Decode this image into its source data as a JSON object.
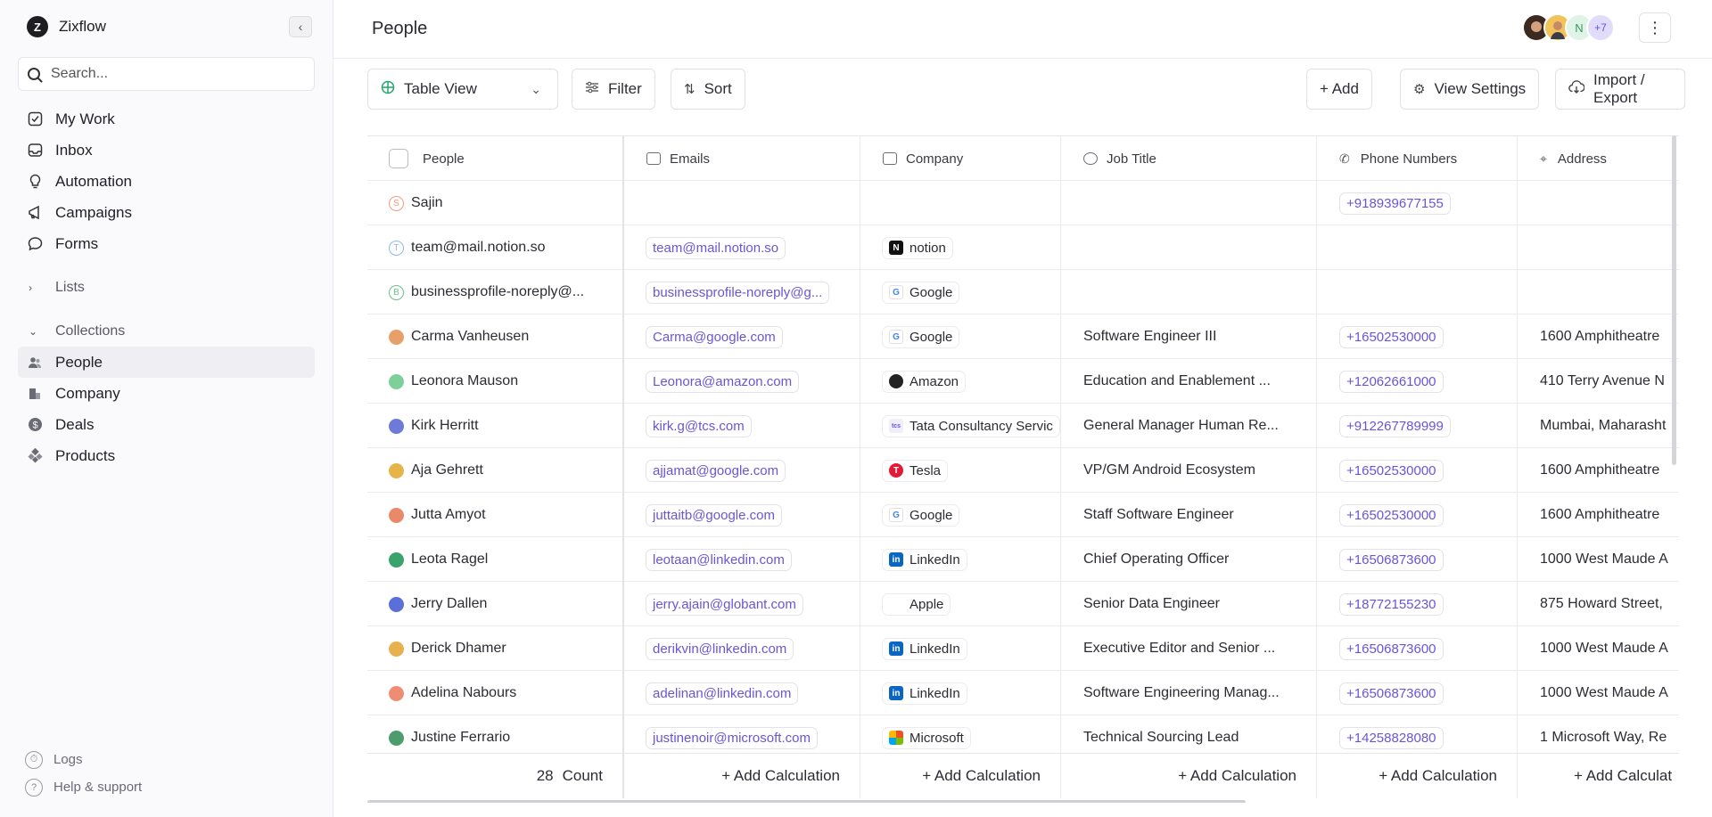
{
  "sidebar": {
    "brand": "Zixflow",
    "search_placeholder": "Search...",
    "nav": [
      {
        "label": "My Work",
        "icon": "check-square-icon"
      },
      {
        "label": "Inbox",
        "icon": "inbox-icon"
      },
      {
        "label": "Automation",
        "icon": "bulb-icon"
      },
      {
        "label": "Campaigns",
        "icon": "megaphone-icon"
      },
      {
        "label": "Forms",
        "icon": "chat-bubble-icon"
      }
    ],
    "lists_label": "Lists",
    "collections_label": "Collections",
    "collections": [
      {
        "label": "People",
        "icon": "people-icon"
      },
      {
        "label": "Company",
        "icon": "building-icon"
      },
      {
        "label": "Deals",
        "icon": "dollar-icon"
      },
      {
        "label": "Products",
        "icon": "cubes-icon"
      }
    ],
    "logs_label": "Logs",
    "help_label": "Help & support"
  },
  "header": {
    "title": "People",
    "avatar_initial": "N",
    "avatar_more": "+7"
  },
  "toolbar": {
    "view": "Table View",
    "filter": "Filter",
    "sort": "Sort",
    "add": "+ Add",
    "view_settings": "View Settings",
    "import_export": "Import / Export"
  },
  "table": {
    "columns": [
      "People",
      "Emails",
      "Company",
      "Job Title",
      "Phone Numbers",
      "Address"
    ],
    "rows": [
      {
        "name": "Sajin",
        "initial": "S",
        "email": "",
        "company": "",
        "job": "",
        "phone": "+918939677155",
        "address": ""
      },
      {
        "name": "team@mail.notion.so",
        "initial": "T",
        "email": "team@mail.notion.so",
        "company": "notion",
        "job": "",
        "phone": "",
        "address": ""
      },
      {
        "name": "businessprofile-noreply@...",
        "initial": "B",
        "email": "businessprofile-noreply@g...",
        "company": "Google",
        "job": "",
        "phone": "",
        "address": ""
      },
      {
        "name": "Carma Vanheusen",
        "initial": "",
        "email": "Carma@google.com",
        "company": "Google",
        "job": "Software Engineer III",
        "phone": "+16502530000",
        "address": "1600 Amphitheatre"
      },
      {
        "name": "Leonora Mauson",
        "initial": "",
        "email": "Leonora@amazon.com",
        "company": "Amazon",
        "job": "Education and Enablement ...",
        "phone": "+12062661000",
        "address": "410 Terry Avenue N"
      },
      {
        "name": "Kirk Herritt",
        "initial": "",
        "email": "kirk.g@tcs.com",
        "company": "Tata Consultancy Servic",
        "job": "General Manager Human Re...",
        "phone": "+912267789999",
        "address": "Mumbai, Maharasht"
      },
      {
        "name": "Aja Gehrett",
        "initial": "",
        "email": "ajjamat@google.com",
        "company": "Tesla",
        "job": "VP/GM Android Ecosystem",
        "phone": "+16502530000",
        "address": "1600 Amphitheatre"
      },
      {
        "name": "Jutta Amyot",
        "initial": "",
        "email": "juttaitb@google.com",
        "company": "Google",
        "job": "Staff Software Engineer",
        "phone": "+16502530000",
        "address": "1600 Amphitheatre"
      },
      {
        "name": "Leota Ragel",
        "initial": "",
        "email": "leotaan@linkedin.com",
        "company": "LinkedIn",
        "job": "Chief Operating Officer",
        "phone": "+16506873600",
        "address": "1000 West Maude A"
      },
      {
        "name": "Jerry Dallen",
        "initial": "",
        "email": "jerry.ajain@globant.com",
        "company": "Apple",
        "job": "Senior Data Engineer",
        "phone": "+18772155230",
        "address": "875 Howard Street,"
      },
      {
        "name": "Derick Dhamer",
        "initial": "",
        "email": "derikvin@linkedin.com",
        "company": "LinkedIn",
        "job": "Executive Editor and Senior ...",
        "phone": "+16506873600",
        "address": "1000 West Maude A"
      },
      {
        "name": "Adelina Nabours",
        "initial": "",
        "email": "adelinan@linkedin.com",
        "company": "LinkedIn",
        "job": "Software Engineering Manag...",
        "phone": "+16506873600",
        "address": "1000 West Maude A"
      },
      {
        "name": "Justine Ferrario",
        "initial": "",
        "email": "justinenoir@microsoft.com",
        "company": "Microsoft",
        "job": "Technical Sourcing Lead",
        "phone": "+14258828080",
        "address": "1 Microsoft Way, Re"
      }
    ],
    "footer": {
      "count": "28",
      "count_label": "Count",
      "add_calc": "+ Add Calculation",
      "add_calc_truncated": "+ Add Calculat"
    }
  },
  "colors": {
    "accent": "#6a55d8",
    "sidebar_bg": "#faf9fb",
    "active_bg": "#efeef2"
  }
}
